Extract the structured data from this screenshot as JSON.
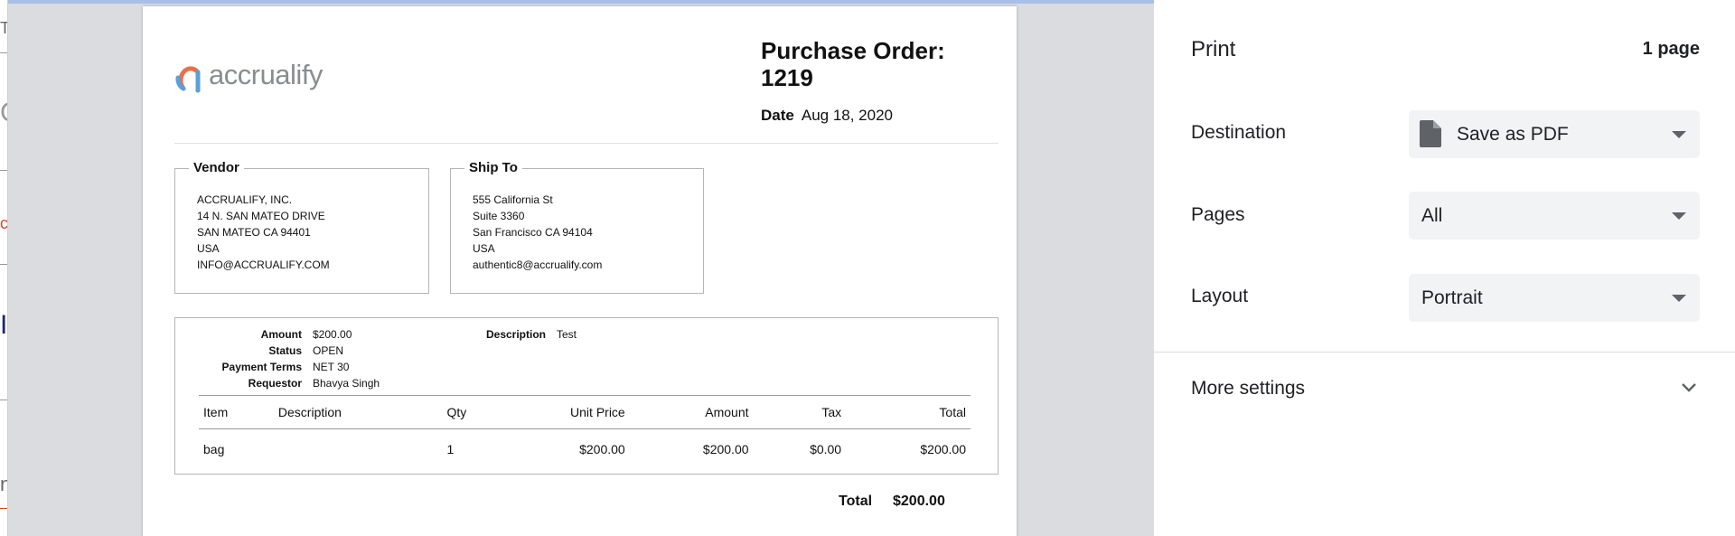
{
  "background_app": {
    "fragments": [
      "T",
      "C",
      "c",
      "I",
      "nt"
    ]
  },
  "document": {
    "logo_text": "accrualify",
    "title_label": "Purchase Order:",
    "po_number": "1219",
    "date_label": "Date",
    "date_value": "Aug 18, 2020",
    "vendor": {
      "heading": "Vendor",
      "lines": [
        "ACCRUALIFY, INC.",
        "14 N. SAN MATEO DRIVE",
        "SAN MATEO CA 94401",
        "USA",
        "INFO@ACCRUALIFY.COM"
      ]
    },
    "ship_to": {
      "heading": "Ship To",
      "lines": [
        "555 California St",
        "Suite 3360",
        "San Francisco CA 94104",
        "USA",
        "authentic8@accrualify.com"
      ]
    },
    "details": {
      "amount_label": "Amount",
      "amount_value": "$200.00",
      "status_label": "Status",
      "status_value": "OPEN",
      "payment_terms_label": "Payment Terms",
      "payment_terms_value": "NET 30",
      "requestor_label": "Requestor",
      "requestor_value": "Bhavya Singh",
      "description_label": "Description",
      "description_value": "Test"
    },
    "items_table": {
      "columns": [
        "Item",
        "Description",
        "Qty",
        "Unit Price",
        "Amount",
        "Tax",
        "Total"
      ],
      "rows": [
        [
          "bag",
          "",
          "1",
          "$200.00",
          "$200.00",
          "$0.00",
          "$200.00"
        ]
      ]
    },
    "total_label": "Total",
    "total_value": "$200.00"
  },
  "print_panel": {
    "title": "Print",
    "page_count": "1 page",
    "destination_label": "Destination",
    "destination_value": "Save as PDF",
    "pages_label": "Pages",
    "pages_value": "All",
    "layout_label": "Layout",
    "layout_value": "Portrait",
    "more_settings_label": "More settings"
  },
  "colors": {
    "logo_orange": "#e8704a",
    "logo_blue": "#5aa0d8",
    "logo_text": "#8a8d90",
    "panel_dropdown_bg": "#f1f3f4",
    "preview_bg": "#dadce0"
  }
}
